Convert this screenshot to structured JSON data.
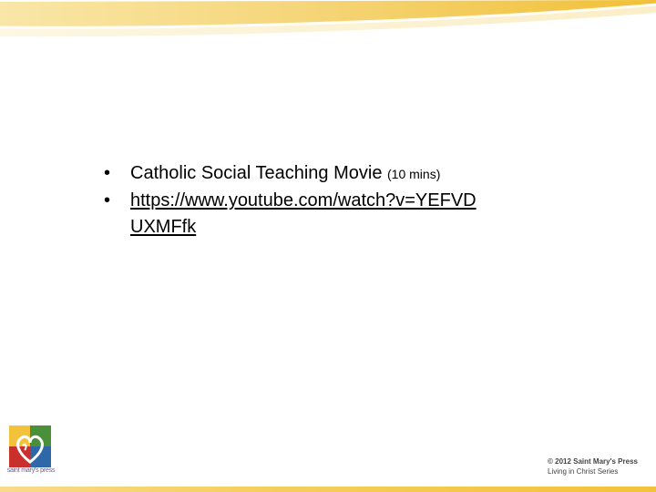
{
  "slide": {
    "bullets": [
      {
        "text": "Catholic Social Teaching Movie ",
        "note": "(10 mins)"
      },
      {
        "link_line1": "https://www.youtube.com/watch?v=YEFVD",
        "link_line2": "UXMFfk"
      }
    ],
    "bullet_symbol": "•"
  },
  "footer": {
    "publisher_logo_text": "saint mary's press",
    "copyright_line": "© 2012 Saint Mary's Press",
    "series_line": "Living in Christ Series"
  },
  "colors": {
    "accent_gold": "#f2c33a",
    "accent_light": "#f7e3a0"
  }
}
